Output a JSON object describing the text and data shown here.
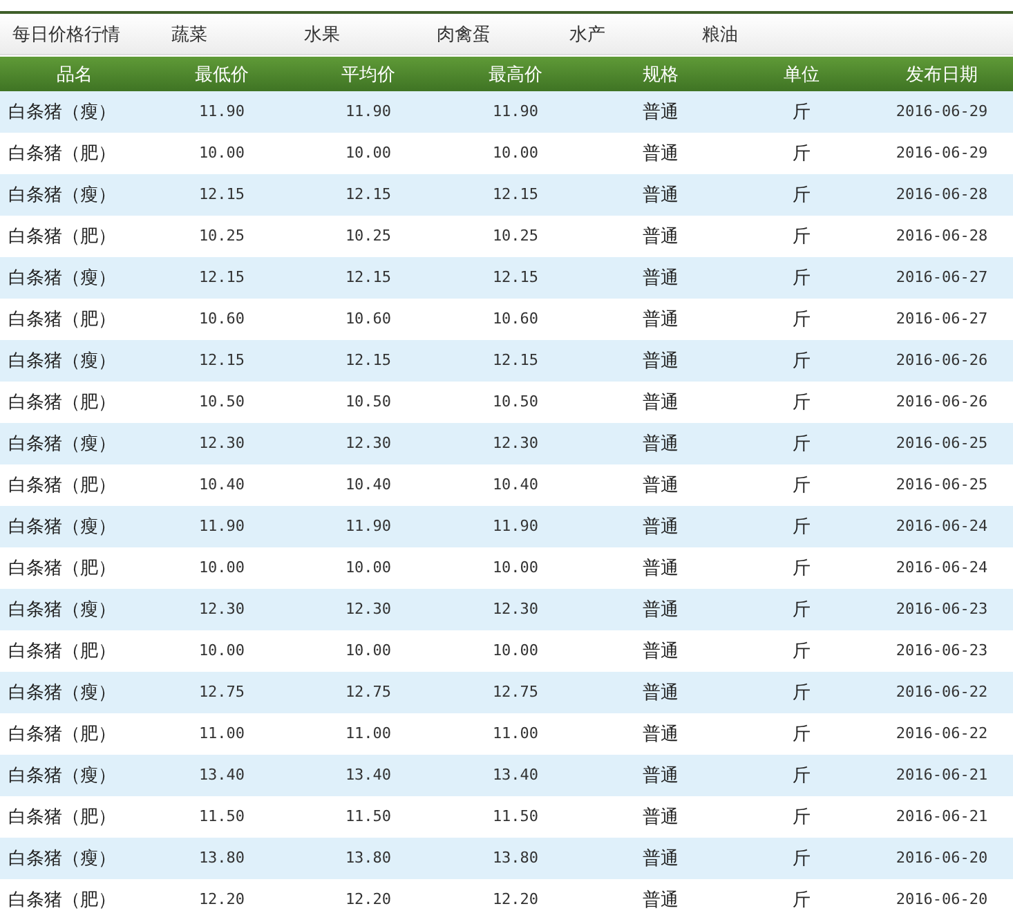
{
  "tabs": [
    {
      "label": "每日价格行情"
    },
    {
      "label": "蔬菜"
    },
    {
      "label": "水果"
    },
    {
      "label": "肉禽蛋"
    },
    {
      "label": "水产"
    },
    {
      "label": "粮油"
    }
  ],
  "table": {
    "columns": [
      "品名",
      "最低价",
      "平均价",
      "最高价",
      "规格",
      "单位",
      "发布日期"
    ],
    "rows": [
      [
        "白条猪（瘦）",
        "11.90",
        "11.90",
        "11.90",
        "普通",
        "斤",
        "2016-06-29"
      ],
      [
        "白条猪（肥）",
        "10.00",
        "10.00",
        "10.00",
        "普通",
        "斤",
        "2016-06-29"
      ],
      [
        "白条猪（瘦）",
        "12.15",
        "12.15",
        "12.15",
        "普通",
        "斤",
        "2016-06-28"
      ],
      [
        "白条猪（肥）",
        "10.25",
        "10.25",
        "10.25",
        "普通",
        "斤",
        "2016-06-28"
      ],
      [
        "白条猪（瘦）",
        "12.15",
        "12.15",
        "12.15",
        "普通",
        "斤",
        "2016-06-27"
      ],
      [
        "白条猪（肥）",
        "10.60",
        "10.60",
        "10.60",
        "普通",
        "斤",
        "2016-06-27"
      ],
      [
        "白条猪（瘦）",
        "12.15",
        "12.15",
        "12.15",
        "普通",
        "斤",
        "2016-06-26"
      ],
      [
        "白条猪（肥）",
        "10.50",
        "10.50",
        "10.50",
        "普通",
        "斤",
        "2016-06-26"
      ],
      [
        "白条猪（瘦）",
        "12.30",
        "12.30",
        "12.30",
        "普通",
        "斤",
        "2016-06-25"
      ],
      [
        "白条猪（肥）",
        "10.40",
        "10.40",
        "10.40",
        "普通",
        "斤",
        "2016-06-25"
      ],
      [
        "白条猪（瘦）",
        "11.90",
        "11.90",
        "11.90",
        "普通",
        "斤",
        "2016-06-24"
      ],
      [
        "白条猪（肥）",
        "10.00",
        "10.00",
        "10.00",
        "普通",
        "斤",
        "2016-06-24"
      ],
      [
        "白条猪（瘦）",
        "12.30",
        "12.30",
        "12.30",
        "普通",
        "斤",
        "2016-06-23"
      ],
      [
        "白条猪（肥）",
        "10.00",
        "10.00",
        "10.00",
        "普通",
        "斤",
        "2016-06-23"
      ],
      [
        "白条猪（瘦）",
        "12.75",
        "12.75",
        "12.75",
        "普通",
        "斤",
        "2016-06-22"
      ],
      [
        "白条猪（肥）",
        "11.00",
        "11.00",
        "11.00",
        "普通",
        "斤",
        "2016-06-22"
      ],
      [
        "白条猪（瘦）",
        "13.40",
        "13.40",
        "13.40",
        "普通",
        "斤",
        "2016-06-21"
      ],
      [
        "白条猪（肥）",
        "11.50",
        "11.50",
        "11.50",
        "普通",
        "斤",
        "2016-06-21"
      ],
      [
        "白条猪（瘦）",
        "13.80",
        "13.80",
        "13.80",
        "普通",
        "斤",
        "2016-06-20"
      ],
      [
        "白条猪（肥）",
        "12.20",
        "12.20",
        "12.20",
        "普通",
        "斤",
        "2016-06-20"
      ]
    ]
  }
}
